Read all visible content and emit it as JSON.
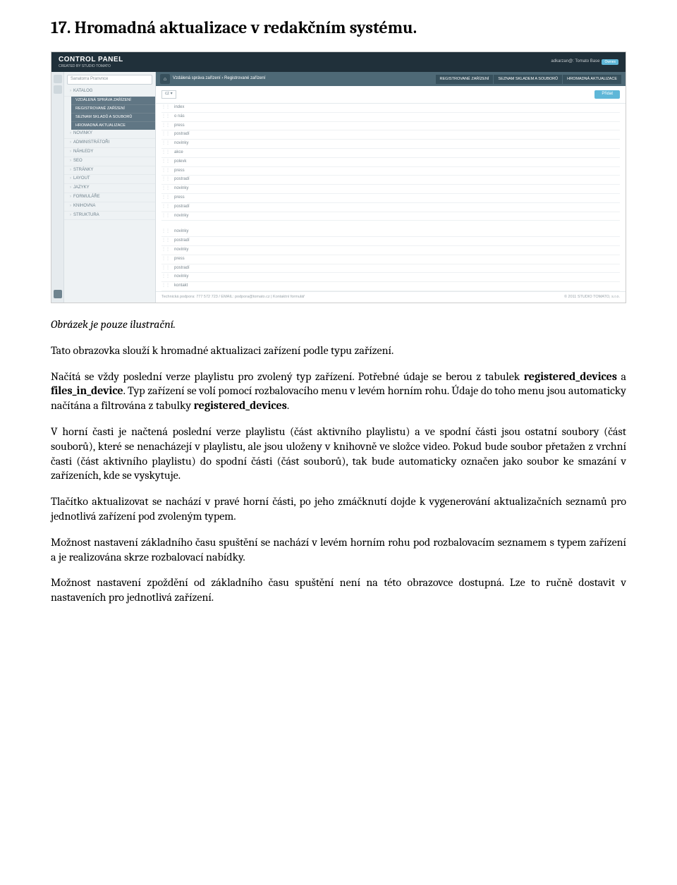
{
  "heading": "17. Hromadná aktualizace v redakčním systému.",
  "screenshot": {
    "header_title": "CONTROL PANEL",
    "header_sub": "CREATED BY STUDIO TOMATO",
    "header_right_text": "adkarzan@: Tomato Base",
    "header_right_btn": "Ownes",
    "search_placeholder": "Sanatorra Pranvnce",
    "sidebar": [
      {
        "label": "KATALOG",
        "subs": [
          "VZDÁLENÁ SPRÁVA ZAŘÍZENÍ",
          "REGISTROVANÉ ZAŘÍZENÍ",
          "SEZNAM SKLADŮ A SOUBORŮ",
          "HROMADNÁ AKTUALIZACE"
        ]
      },
      {
        "label": "NOVINKY"
      },
      {
        "label": "ADMINISTRÁTOŘI"
      },
      {
        "label": "NÁHLEDY"
      },
      {
        "label": "SEO"
      },
      {
        "label": "STRÁNKY"
      },
      {
        "label": "LAYOUT"
      },
      {
        "label": "JAZYKY"
      },
      {
        "label": "FORMULÁŘE"
      },
      {
        "label": "KNIHOVNA"
      },
      {
        "label": "STRUKTURA"
      }
    ],
    "breadcrumb": "Vzdálená správa zařízení › Registrované zařízení",
    "tabs": [
      "REGISTROVANÉ ZAŘÍZENÍ",
      "SEZNAM SKLADEM A SOUBORŮ",
      "HROMADNÁ AKTUALIZACE"
    ],
    "lang_select": "cz ▾",
    "action_btn": "Přidat",
    "rows_top": [
      "index",
      "o nás",
      "press",
      "postradí",
      "novinky",
      "akce",
      "polevk",
      "press",
      "postradí",
      "novinky",
      "press",
      "postradí",
      "novinky"
    ],
    "rows_bottom": [
      "novinky",
      "postradí",
      "novinky",
      "press",
      "postradí",
      "novinky",
      "kontakt"
    ],
    "footer_left": "Technická podpora: 777 572 723 / EMAIL: podpora@tomato.cz | Kontaktní formulář",
    "footer_right": "© 2011 STUDIO TOMATO, s.r.o."
  },
  "note": "Obrázek je pouze ilustrační.",
  "paragraphs": {
    "p1": "Tato obrazovka slouží k hromadné aktualizaci zařízení podle typu zařízení.",
    "p2_a": "Načítá se vždy poslední verze playlistu pro zvolený typ zařízení. Potřebné údaje se berou z tabulek ",
    "p2_b1": "registered_devices",
    "p2_c": " a ",
    "p2_b2": "files_in_device",
    "p2_d": ". Typ zařízení se volí pomocí rozbalovacího menu v levém horním rohu. Údaje do toho menu jsou automaticky načítána a filtrována z tabulky ",
    "p2_b3": "registered_devices",
    "p2_e": ".",
    "p3": "V horní časti je načtená poslední verze playlistu (část aktivního playlistu) a ve spodní části jsou ostatní soubory (část souborů), které se nenacházejí v playlistu, ale jsou uloženy v knihovně ve složce video. Pokud bude soubor přetažen z vrchní časti (část aktivního playlistu) do spodní části (část souborů), tak bude automaticky označen jako soubor ke smazání v zařízeních, kde se vyskytuje.",
    "p4": "Tlačítko aktualizovat se nachází v pravé horní části, po jeho zmáčknutí dojde k vygenerování aktualizačních seznamů pro jednotlivá zařízení pod zvoleným typem.",
    "p5": "Možnost nastavení základního času spuštění se nachází v levém horním rohu pod rozbalovacím seznamem s typem zařízení a je realizována skrze rozbalovací nabídky.",
    "p6": "Možnost nastavení zpoždění od základního času spuštění není na této obrazovce dostupná. Lze to ručně dostavit v nastaveních pro jednotlivá zařízení."
  }
}
